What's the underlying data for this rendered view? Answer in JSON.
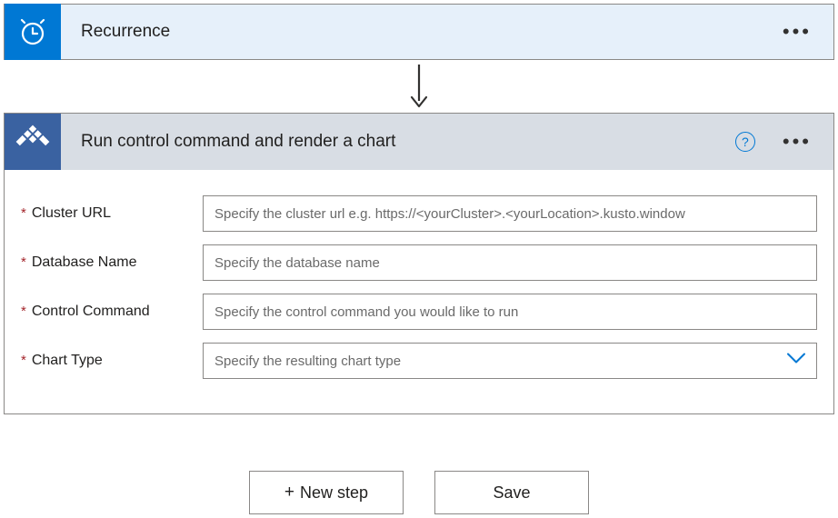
{
  "recurrence": {
    "title": "Recurrence"
  },
  "action": {
    "title": "Run control command and render a chart",
    "fields": {
      "cluster_url": {
        "label": "Cluster URL",
        "placeholder": "Specify the cluster url e.g. https://<yourCluster>.<yourLocation>.kusto.window"
      },
      "database_name": {
        "label": "Database Name",
        "placeholder": "Specify the database name"
      },
      "control_command": {
        "label": "Control Command",
        "placeholder": "Specify the control command you would like to run"
      },
      "chart_type": {
        "label": "Chart Type",
        "placeholder": "Specify the resulting chart type"
      }
    }
  },
  "buttons": {
    "new_step": "New step",
    "plus": "+",
    "save": "Save"
  },
  "help_glyph": "?"
}
